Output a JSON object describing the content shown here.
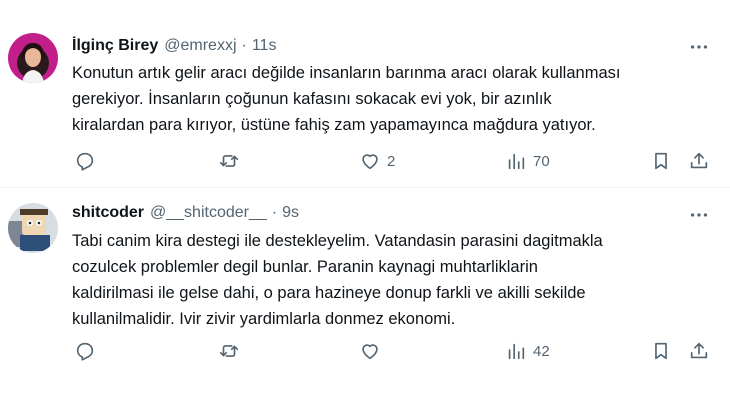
{
  "tweets": [
    {
      "display_name": "İlginç Birey",
      "handle": "@emrexxj",
      "separator": "·",
      "time": "11s",
      "text_lines": [
        "Konutun artık gelir aracı değilde insanların barınma aracı olarak kullanması",
        "gerekiyor. İnsanların çoğunun kafasını sokacak evi yok, bir azınlık",
        "kiralardan para kırıyor, üstüne fahiş zam yapamayınca mağdura yatıyor."
      ],
      "likes": "2",
      "views": "70",
      "icons": [
        "more-icon",
        "reply-icon",
        "retweet-icon",
        "like-icon",
        "views-icon",
        "bookmark-icon",
        "share-icon"
      ]
    },
    {
      "display_name": "shitcoder",
      "handle": "@__shitcoder__",
      "separator": "·",
      "time": "9s",
      "text_lines": [
        "Tabi canim kira destegi ile destekleyelim. Vatandasin parasini dagitmakla",
        "cozulcek problemler degil bunlar. Paranin kaynagi muhtarliklarin",
        "kaldirilmasi ile gelse dahi, o para hazineye donup farkli ve akilli sekilde",
        "kullanilmalidir. Ivir zivir yardimlarla donmez ekonomi."
      ],
      "likes": "",
      "views": "42",
      "icons": [
        "more-icon",
        "reply-icon",
        "retweet-icon",
        "like-icon",
        "views-icon",
        "bookmark-icon",
        "share-icon"
      ]
    }
  ],
  "colors": {
    "text_primary": "#0f1419",
    "text_secondary": "#536471",
    "divider": "#eff3f4",
    "background": "#ffffff"
  }
}
